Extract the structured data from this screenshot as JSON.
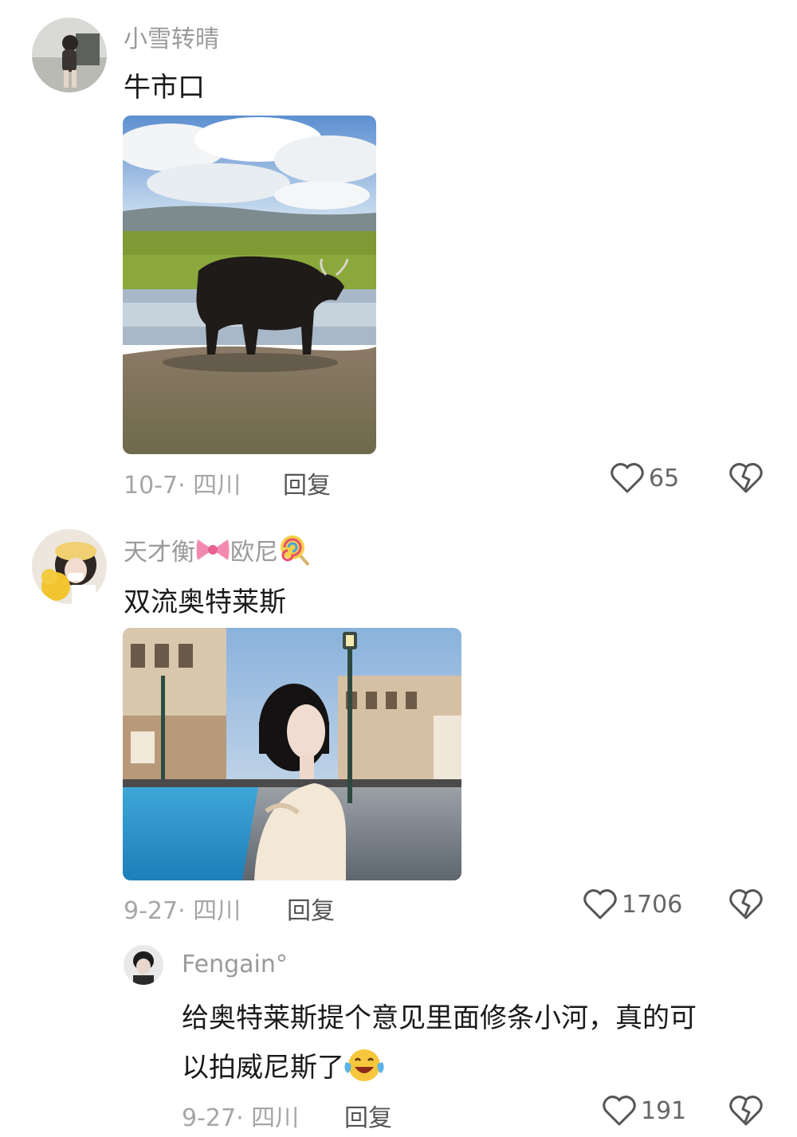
{
  "comments": [
    {
      "username": "小雪转晴",
      "text": "牛市口",
      "date_location": "10-7· 四川",
      "reply_label": "回复",
      "likes": "65",
      "photo_icon": "yak-on-grassland-photo"
    },
    {
      "username_part1": "天才衡",
      "username_part2": "欧尼",
      "username_emojis": [
        "ribbon-bow-emoji",
        "lollipop-emoji"
      ],
      "text": "双流奥特莱斯",
      "date_location": "9-27· 四川",
      "reply_label": "回复",
      "likes": "1706",
      "photo_icon": "venetian-street-portrait-photo",
      "replies": [
        {
          "username": "Fengain°",
          "text_line1": "给奥特莱斯提个意见里面修条小河，真的可",
          "text_line2": "以拍威尼斯了",
          "emoji": "laughing-crying-emoji",
          "date_location": "9-27· 四川",
          "reply_label": "回复",
          "likes": "191"
        }
      ]
    }
  ],
  "colors": {
    "username": "#9a9a9a",
    "comment_text": "#1a1a1a",
    "meta": "#a6a6a6",
    "icon": "#555555"
  }
}
